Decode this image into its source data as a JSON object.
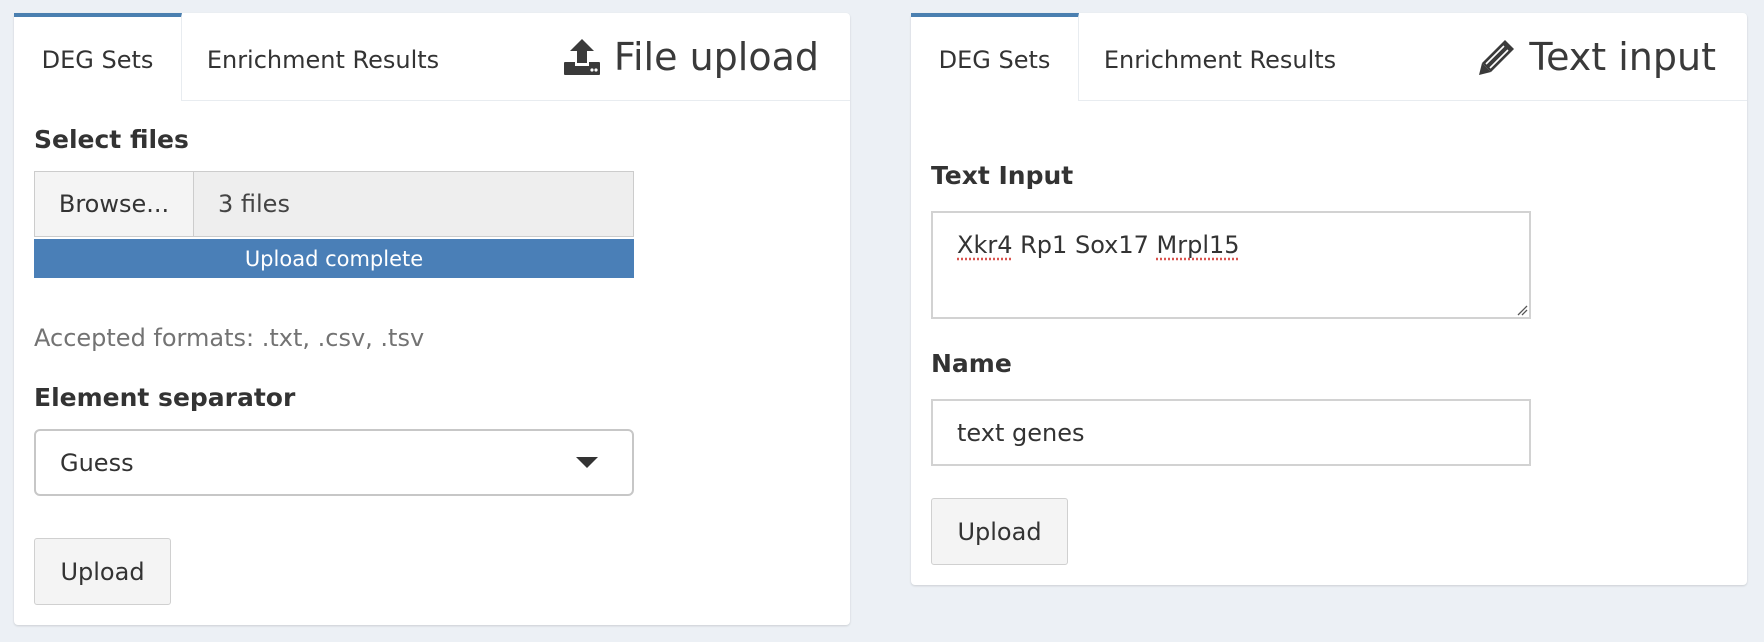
{
  "left_panel": {
    "tabs": [
      {
        "label": "DEG Sets",
        "active": true
      },
      {
        "label": "Enrichment Results",
        "active": false
      }
    ],
    "title": "File upload",
    "title_icon": "upload-icon",
    "select_files_label": "Select files",
    "browse_label": "Browse...",
    "file_name": "3 files",
    "progress_text": "Upload complete",
    "progress_value": 1.0,
    "help_text": "Accepted formats: .txt, .csv, .tsv",
    "separator_label": "Element separator",
    "separator_value": "Guess",
    "upload_label": "Upload"
  },
  "right_panel": {
    "tabs": [
      {
        "label": "DEG Sets",
        "active": true
      },
      {
        "label": "Enrichment Results",
        "active": false
      }
    ],
    "title": "Text input",
    "title_icon": "pencil-icon",
    "text_input_label": "Text Input",
    "text_input_words": [
      "Xkr4",
      "Rp1",
      "Sox17",
      "Mrpl15"
    ],
    "name_label": "Name",
    "name_value": "text genes",
    "upload_label": "Upload"
  },
  "colors": {
    "accent": "#4a7fb7",
    "background": "#ecf0f5",
    "panel": "#ffffff"
  }
}
